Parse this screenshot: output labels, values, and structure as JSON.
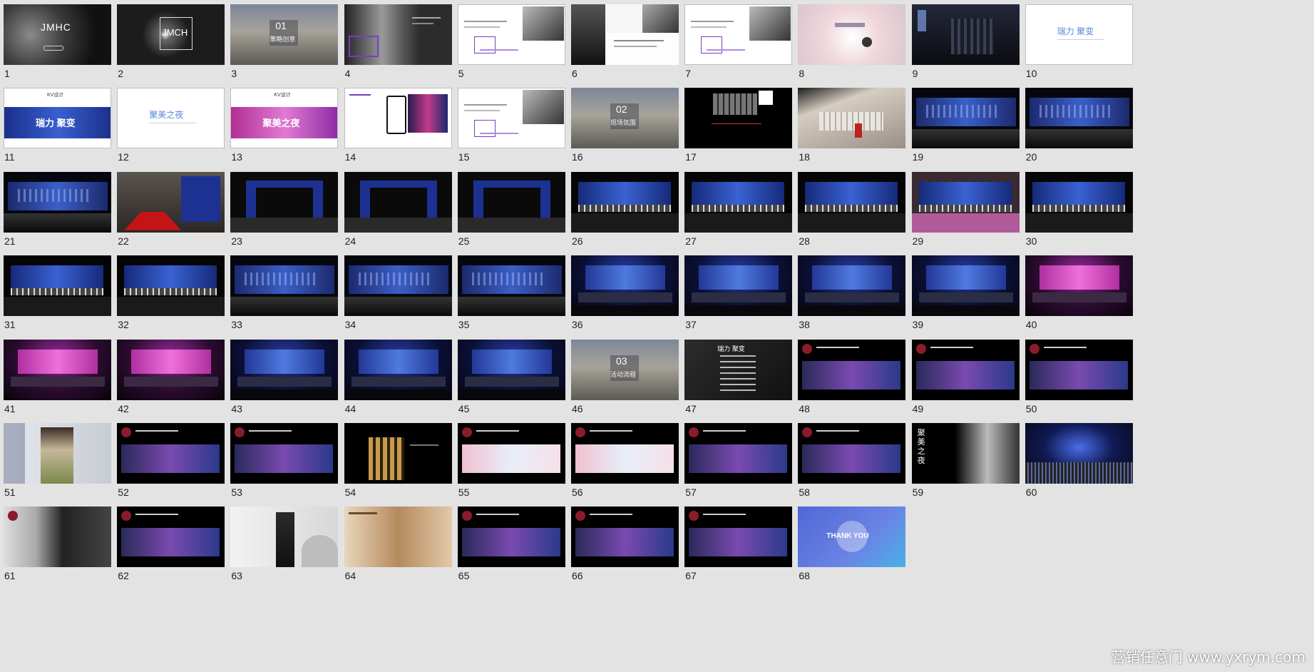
{
  "slides": [
    {
      "n": "1",
      "kind": "title-dark",
      "bg": "#2a2a2a",
      "title": "JMHC",
      "caption": ""
    },
    {
      "n": "2",
      "kind": "title-box",
      "bg": "#1c1c1c",
      "title": "JMCH",
      "caption": ""
    },
    {
      "n": "3",
      "kind": "section",
      "bg": "#8a8f9a",
      "title": "01",
      "caption": "策略创意"
    },
    {
      "n": "4",
      "kind": "portrait",
      "bg": "#3a3a3a",
      "title": "",
      "caption": ""
    },
    {
      "n": "5",
      "kind": "white-photo",
      "bg": "#ffffff",
      "title": "",
      "caption": ""
    },
    {
      "n": "6",
      "kind": "collage",
      "bg": "#222222",
      "title": "",
      "caption": ""
    },
    {
      "n": "7",
      "kind": "white-photo",
      "bg": "#ffffff",
      "title": "",
      "caption": ""
    },
    {
      "n": "8",
      "kind": "hands",
      "bg": "#f1e4e6",
      "title": "",
      "caption": ""
    },
    {
      "n": "9",
      "kind": "dark-city",
      "bg": "#1e2230",
      "title": "",
      "caption": ""
    },
    {
      "n": "10",
      "kind": "white-text",
      "bg": "#ffffff",
      "title": "瑞力 聚变",
      "caption": ""
    },
    {
      "n": "11",
      "kind": "kv",
      "bg": "#ffffff",
      "title": "KV设计",
      "caption": "瑞力 聚变"
    },
    {
      "n": "12",
      "kind": "white-text",
      "bg": "#ffffff",
      "title": "聚美之夜",
      "caption": ""
    },
    {
      "n": "13",
      "kind": "kv-pink",
      "bg": "#ffffff",
      "title": "KV设计",
      "caption": "聚美之夜"
    },
    {
      "n": "14",
      "kind": "phone",
      "bg": "#ffffff",
      "title": "",
      "caption": ""
    },
    {
      "n": "15",
      "kind": "white-photo",
      "bg": "#ffffff",
      "title": "",
      "caption": ""
    },
    {
      "n": "16",
      "kind": "section",
      "bg": "#8a8f9a",
      "title": "02",
      "caption": "现场氛围"
    },
    {
      "n": "17",
      "kind": "floorplan",
      "bg": "#000000",
      "title": "",
      "caption": ""
    },
    {
      "n": "18",
      "kind": "venue-3d",
      "bg": "#d8d0c8",
      "title": "",
      "caption": ""
    },
    {
      "n": "19",
      "kind": "stage-blue",
      "bg": "#05070f",
      "title": "",
      "caption": ""
    },
    {
      "n": "20",
      "kind": "stage-blue",
      "bg": "#05070f",
      "title": "",
      "caption": ""
    },
    {
      "n": "21",
      "kind": "stage-blue",
      "bg": "#05070f",
      "title": "",
      "caption": ""
    },
    {
      "n": "22",
      "kind": "redcarpet",
      "bg": "#1a1a1a",
      "title": "",
      "caption": ""
    },
    {
      "n": "23",
      "kind": "gate",
      "bg": "#0a0a0a",
      "title": "",
      "caption": ""
    },
    {
      "n": "24",
      "kind": "gate",
      "bg": "#0a0a0a",
      "title": "",
      "caption": ""
    },
    {
      "n": "25",
      "kind": "gate",
      "bg": "#0a0a0a",
      "title": "",
      "caption": ""
    },
    {
      "n": "26",
      "kind": "wall",
      "bg": "#050505",
      "title": "",
      "caption": ""
    },
    {
      "n": "27",
      "kind": "wall",
      "bg": "#050505",
      "title": "",
      "caption": ""
    },
    {
      "n": "28",
      "kind": "wall",
      "bg": "#050505",
      "title": "",
      "caption": ""
    },
    {
      "n": "29",
      "kind": "wall-pink",
      "bg": "#2a2028",
      "title": "",
      "caption": ""
    },
    {
      "n": "30",
      "kind": "wall",
      "bg": "#050505",
      "title": "",
      "caption": ""
    },
    {
      "n": "31",
      "kind": "wall",
      "bg": "#050505",
      "title": "",
      "caption": ""
    },
    {
      "n": "32",
      "kind": "wall",
      "bg": "#050505",
      "title": "",
      "caption": ""
    },
    {
      "n": "33",
      "kind": "stage-blue",
      "bg": "#05070f",
      "title": "",
      "caption": ""
    },
    {
      "n": "34",
      "kind": "stage-blue",
      "bg": "#05070f",
      "title": "",
      "caption": ""
    },
    {
      "n": "35",
      "kind": "stage-blue",
      "bg": "#05070f",
      "title": "",
      "caption": ""
    },
    {
      "n": "36",
      "kind": "stage-big",
      "bg": "#06081a",
      "title": "",
      "caption": ""
    },
    {
      "n": "37",
      "kind": "stage-big",
      "bg": "#06081a",
      "title": "",
      "caption": ""
    },
    {
      "n": "38",
      "kind": "stage-big",
      "bg": "#06081a",
      "title": "",
      "caption": ""
    },
    {
      "n": "39",
      "kind": "stage-big",
      "bg": "#06081a",
      "title": "",
      "caption": ""
    },
    {
      "n": "40",
      "kind": "stage-pink",
      "bg": "#0d0510",
      "title": "",
      "caption": ""
    },
    {
      "n": "41",
      "kind": "stage-pink",
      "bg": "#0d0510",
      "title": "",
      "caption": ""
    },
    {
      "n": "42",
      "kind": "stage-pink",
      "bg": "#0d0510",
      "title": "",
      "caption": ""
    },
    {
      "n": "43",
      "kind": "stage-big",
      "bg": "#06081a",
      "title": "",
      "caption": ""
    },
    {
      "n": "44",
      "kind": "stage-big",
      "bg": "#06081a",
      "title": "",
      "caption": ""
    },
    {
      "n": "45",
      "kind": "stage-big",
      "bg": "#06081a",
      "title": "",
      "caption": ""
    },
    {
      "n": "46",
      "kind": "section",
      "bg": "#8a8f9a",
      "title": "03",
      "caption": "活动流程"
    },
    {
      "n": "47",
      "kind": "dark-list",
      "bg": "#1d1d1d",
      "title": "瑞力 聚变",
      "caption": ""
    },
    {
      "n": "48",
      "kind": "dark-photo",
      "bg": "#000000",
      "title": "",
      "caption": ""
    },
    {
      "n": "49",
      "kind": "dark-photo",
      "bg": "#000000",
      "title": "",
      "caption": ""
    },
    {
      "n": "50",
      "kind": "dark-photo",
      "bg": "#000000",
      "title": "",
      "caption": ""
    },
    {
      "n": "51",
      "kind": "speaker",
      "bg": "#d9dce2",
      "title": "",
      "caption": ""
    },
    {
      "n": "52",
      "kind": "dark-photo",
      "bg": "#000000",
      "title": "",
      "caption": ""
    },
    {
      "n": "53",
      "kind": "dark-photo",
      "bg": "#000000",
      "title": "",
      "caption": ""
    },
    {
      "n": "54",
      "kind": "gold",
      "bg": "#000000",
      "title": "",
      "caption": ""
    },
    {
      "n": "55",
      "kind": "dark-photo-light",
      "bg": "#000000",
      "title": "",
      "caption": ""
    },
    {
      "n": "56",
      "kind": "dark-photo-light",
      "bg": "#000000",
      "title": "",
      "caption": ""
    },
    {
      "n": "57",
      "kind": "dark-photo",
      "bg": "#000000",
      "title": "",
      "caption": ""
    },
    {
      "n": "58",
      "kind": "dark-photo",
      "bg": "#000000",
      "title": "",
      "caption": ""
    },
    {
      "n": "59",
      "kind": "face",
      "bg": "#000000",
      "title": "聚美之夜",
      "caption": ""
    },
    {
      "n": "60",
      "kind": "concert",
      "bg": "#0a0f25",
      "title": "",
      "caption": ""
    },
    {
      "n": "61",
      "kind": "fashion",
      "bg": "#1a1a1a",
      "title": "",
      "caption": ""
    },
    {
      "n": "62",
      "kind": "dark-photo",
      "bg": "#000000",
      "title": "",
      "caption": ""
    },
    {
      "n": "63",
      "kind": "speaker2",
      "bg": "#e4e4e4",
      "title": "",
      "caption": ""
    },
    {
      "n": "64",
      "kind": "sepia",
      "bg": "#c9a27c",
      "title": "",
      "caption": ""
    },
    {
      "n": "65",
      "kind": "dark-photo",
      "bg": "#000000",
      "title": "",
      "caption": ""
    },
    {
      "n": "66",
      "kind": "dark-photo",
      "bg": "#000000",
      "title": "",
      "caption": ""
    },
    {
      "n": "67",
      "kind": "dark-photo",
      "bg": "#000000",
      "title": "",
      "caption": ""
    },
    {
      "n": "68",
      "kind": "thankyou",
      "bg": "#5b6fd8",
      "title": "THANK YOU",
      "caption": ""
    }
  ],
  "watermark": "营销任意门 www.yxrym.com",
  "colors": {
    "page_bg": "#e3e3e3",
    "accent_purple": "#7a3cc0",
    "stage_blue": "#1c3ea8",
    "stage_pink": "#d23bb6"
  }
}
